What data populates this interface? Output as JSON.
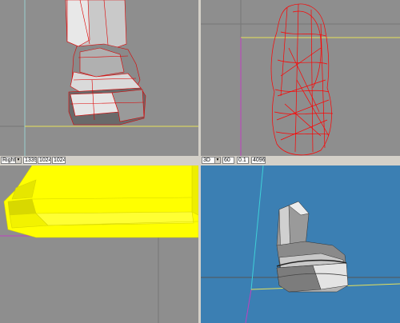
{
  "left_toolbar": {
    "view_select": "Right",
    "field1": "1339",
    "field2": "1024",
    "field3": "1024"
  },
  "right_toolbar": {
    "view_select": "3D",
    "field1": "60",
    "field2": "0.1",
    "field3": "4096"
  },
  "icons": {
    "dropdown": "chevron-down-icon"
  },
  "colors": {
    "viewport_bg": "#8e8e8e",
    "viewport_3d_bg": "#3b7fb3",
    "wire_red": "#ff0000",
    "solid_yellow": "#ffff00",
    "guide_yellow": "#e8e25a",
    "guide_cyan": "#3fd0d8",
    "guide_magenta": "#c040c0"
  }
}
